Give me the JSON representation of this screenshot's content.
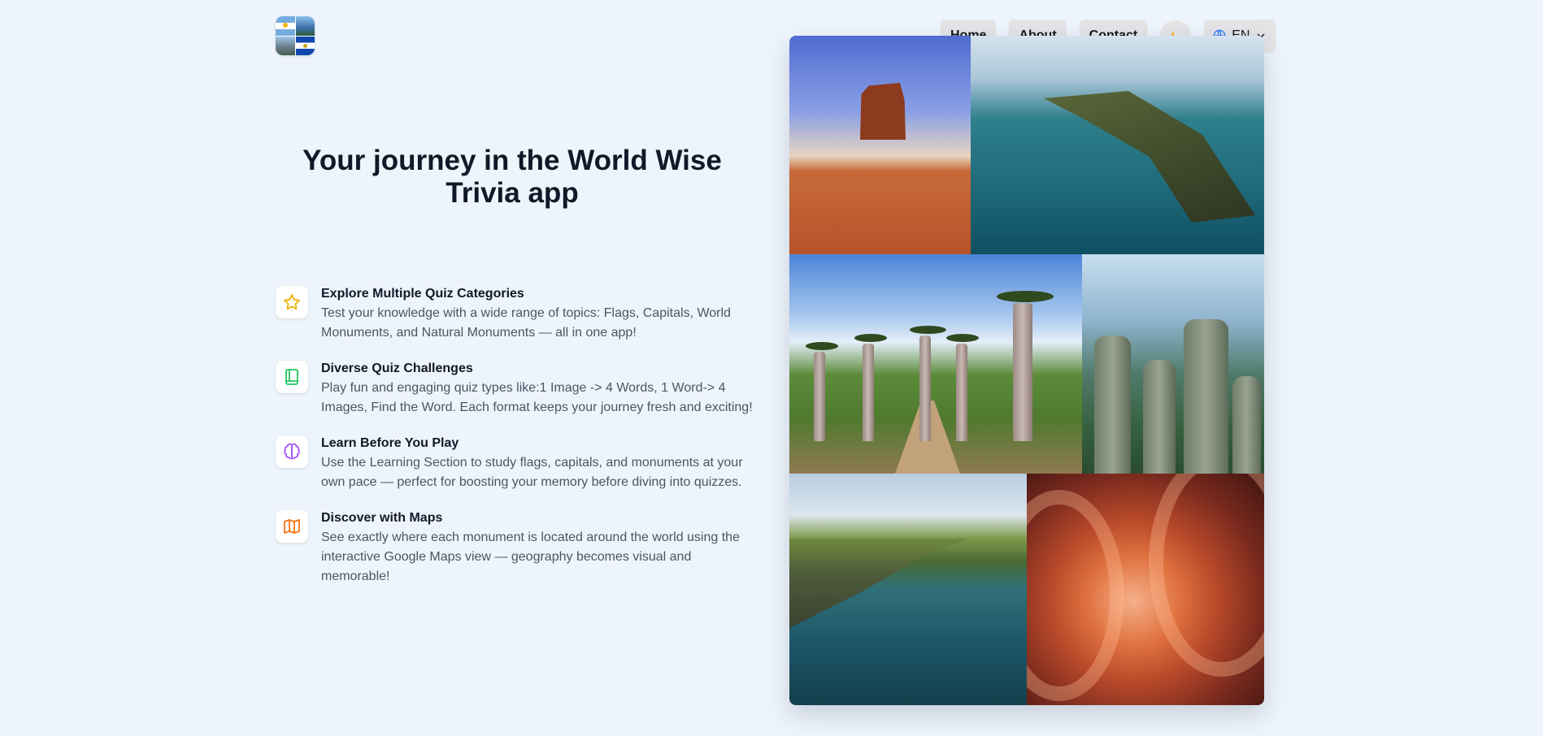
{
  "header": {
    "logo_alt": "World Wise Trivia logo",
    "nav": {
      "home": "Home",
      "about": "About",
      "contact": "Contact",
      "theme_icon": "moon-icon",
      "language": "EN",
      "language_icon": "globe-icon"
    }
  },
  "hero": {
    "title": "Your journey in the World Wise Trivia app"
  },
  "features": [
    {
      "icon": "star-icon",
      "color": "#eab308",
      "title": "Explore Multiple Quiz Categories",
      "description": "Test your knowledge with a wide range of topics: Flags, Capitals, World Monuments, and Natural Monuments — all in one app!"
    },
    {
      "icon": "book-icon",
      "color": "#22c55e",
      "title": "Diverse Quiz Challenges",
      "description": "Play fun and engaging quiz types like:1 Image -> 4 Words, 1 Word-> 4 Images, Find the Word. Each format keeps your journey fresh and exciting!"
    },
    {
      "icon": "brain-icon",
      "color": "#a855f7",
      "title": "Learn Before You Play",
      "description": "Use the Learning Section to study flags, capitals, and monuments at your own pace — perfect for boosting your memory before diving into quizzes."
    },
    {
      "icon": "map-icon",
      "color": "#f97316",
      "title": "Discover with Maps",
      "description": "See exactly where each monument is located around the world using the interactive Google Maps view — geography becomes visual and memorable!"
    }
  ],
  "gallery": {
    "images": [
      "desert-butte-photo",
      "coastal-cape-photo",
      "baobab-avenue-photo",
      "karst-pillars-photo",
      "sea-cliffs-photo",
      "slot-canyon-photo"
    ]
  }
}
